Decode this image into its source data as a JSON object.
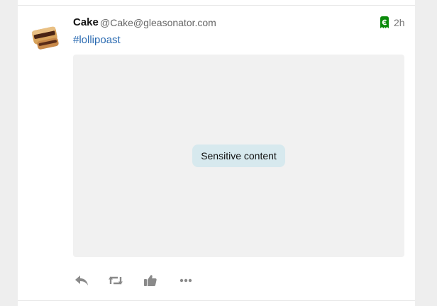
{
  "status": {
    "display_name": "Cake",
    "account": "@Cake@gleasonator.com",
    "hashtag": "#lollipoast",
    "timestamp": "2h",
    "federation_icon_color": "#0a8a0a"
  },
  "media": {
    "sensitive_label": "Sensitive content"
  },
  "actions": {
    "reply_icon": "reply-icon",
    "reblog_icon": "reblog-icon",
    "like_icon": "thumbs-up-icon",
    "more_icon": "more-icon",
    "icon_color": "#8a8a8a"
  }
}
